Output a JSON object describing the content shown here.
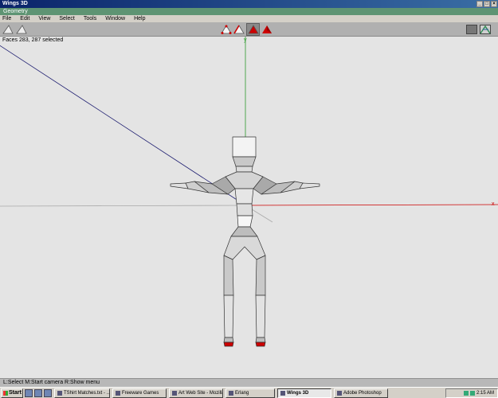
{
  "window": {
    "title": "Wings 3D",
    "minimize": "_",
    "maximize": "□",
    "close": "×"
  },
  "geometry_bar": {
    "label": "Geometry"
  },
  "menu": [
    "File",
    "Edit",
    "View",
    "Select",
    "Tools",
    "Window",
    "Help"
  ],
  "viewport": {
    "selection_info": "Faces 283, 287 selected"
  },
  "status": {
    "text": "L:Select   M:Start camera   R:Show menu"
  },
  "taskbar": {
    "start_label": "Start",
    "tasks": [
      "TShirt Matches.txt - ...",
      "Freeware Games",
      "Art Web Site - Mozilla",
      "Erlang",
      "Wings 3D",
      "Adobe Photoshop"
    ],
    "clock": "2:15 AM"
  },
  "colors": {
    "x_axis": "#cc0000",
    "y_axis": "#009900",
    "z_axis": "#00008b",
    "geometry_bar": "#5e9473",
    "selected_face": "#cc0000"
  }
}
